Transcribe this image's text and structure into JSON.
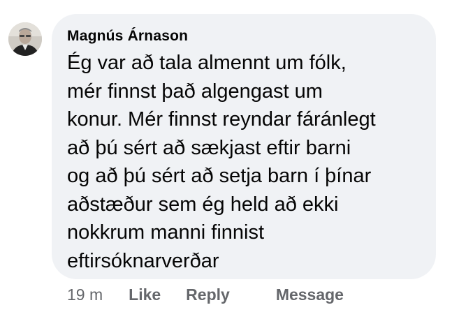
{
  "comment": {
    "author": "Magnús Árnason",
    "text": "Ég var að tala almennt um fólk,\nmér finnst það algengast um\nkonur. Mér finnst reyndar fáránlegt\nað þú sért að sækjast eftir barni\nog að þú sért að setja barn í þínar\naðstæður sem ég held að ekki\nnokkrum manni finnist\neftirsóknarverðar",
    "avatar_icon": "user-avatar-photo"
  },
  "actions": {
    "timestamp": "19 m",
    "like_label": "Like",
    "reply_label": "Reply",
    "message_label": "Message"
  },
  "colors": {
    "bubble_background": "#f0f2f5",
    "text": "#050505",
    "secondary_text": "#65676b"
  }
}
